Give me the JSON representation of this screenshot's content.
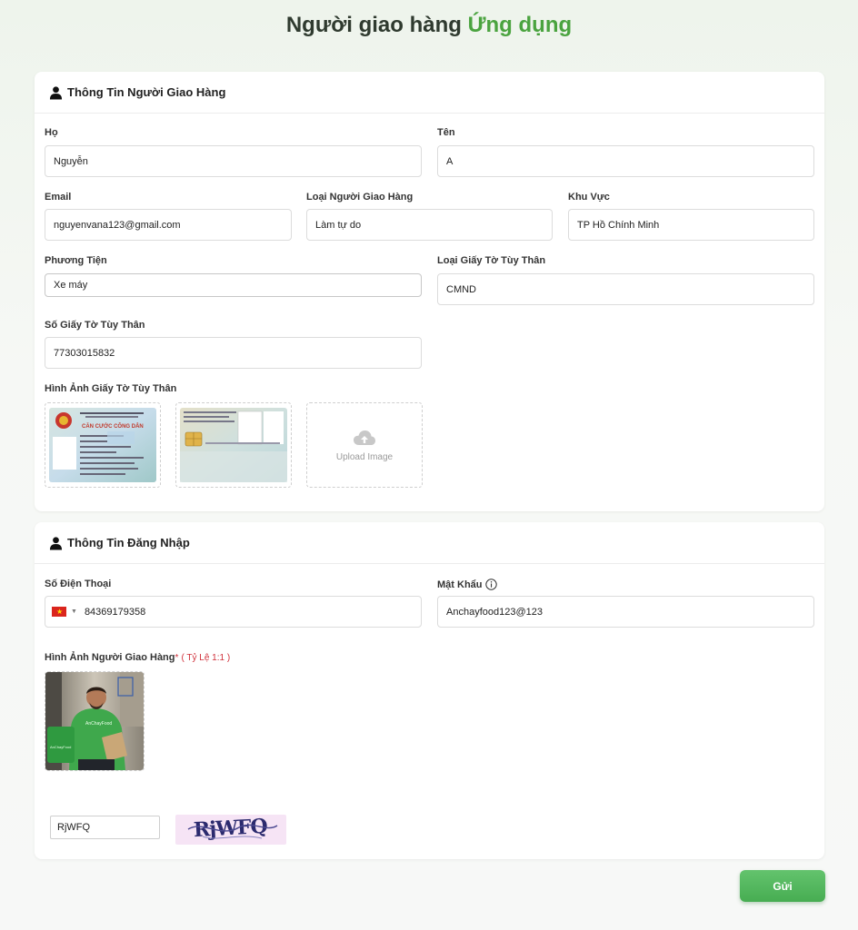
{
  "title": {
    "main": "Người giao hàng",
    "accent": "Ứng dụng"
  },
  "shipper_info": {
    "header": "Thông Tin Người Giao Hàng",
    "last_name": {
      "label": "Họ",
      "value": "Nguyễn"
    },
    "first_name": {
      "label": "Tên",
      "value": "A"
    },
    "email": {
      "label": "Email",
      "value": "nguyenvana123@gmail.com"
    },
    "shipper_type": {
      "label": "Loại Người Giao Hàng",
      "value": "Làm tự do"
    },
    "region": {
      "label": "Khu Vực",
      "value": "TP Hồ Chính Minh"
    },
    "vehicle": {
      "label": "Phương Tiện",
      "value": "Xe máy"
    },
    "id_type": {
      "label": "Loại Giấy Tờ Tùy Thân",
      "value": "CMND"
    },
    "id_number": {
      "label": "Số Giấy Tờ Tùy Thân",
      "value": "77303015832"
    },
    "id_images": {
      "label": "Hình Ảnh Giấy Tờ Tùy Thân",
      "upload_text": "Upload Image",
      "front_card_text": "CĂN CƯỚC CÔNG DÂN"
    }
  },
  "login_info": {
    "header": "Thông Tin Đăng Nhập",
    "phone": {
      "label": "Số Điện Thoại",
      "value": "84369179358"
    },
    "password": {
      "label": "Mật Khẩu",
      "value": "Anchayfood123@123"
    },
    "photo": {
      "label": "Hình Ảnh Người Giao Hàng",
      "required_mark": "*",
      "ratio_note": "( Tỷ Lệ 1:1 )",
      "shirt_text": "AnChayFood"
    },
    "captcha": {
      "input_value": "RjWFQ",
      "image_text": "RjWFQ"
    }
  },
  "submit_label": "Gửi",
  "colors": {
    "accent": "#4aa33f",
    "button": "#4fb45a",
    "required": "#d0303a"
  }
}
